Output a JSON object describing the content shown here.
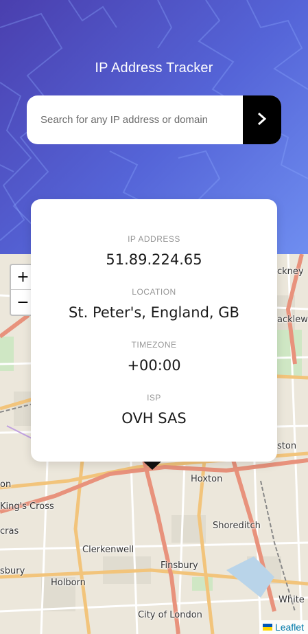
{
  "header": {
    "title": "IP Address Tracker"
  },
  "search": {
    "placeholder": "Search for any IP address or domain",
    "value": "",
    "button_icon": "chevron-right-icon"
  },
  "info": {
    "ip_label": "IP ADDRESS",
    "ip_value": "51.89.224.65",
    "location_label": "LOCATION",
    "location_value": "St. Peter's, England, GB",
    "timezone_label": "TIMEZONE",
    "timezone_value": "+00:00",
    "isp_label": "ISP",
    "isp_value": "OVH SAS"
  },
  "map": {
    "zoom_in": "+",
    "zoom_out": "−",
    "labels": {
      "hoxton": "Hoxton",
      "kings_cross": "King's Cross",
      "shoreditch": "Shoreditch",
      "clerkenwell": "Clerkenwell",
      "finsbury": "Finsbury",
      "holborn": "Holborn",
      "city_of_london": "City of London",
      "hackney": "ckney",
      "hacklewe": "acklewe",
      "aston": "ston",
      "white": "White",
      "crs": "cras",
      "sbury": "sbury",
      "on": "on"
    },
    "attribution": "Leaflet"
  },
  "colors": {
    "hero_start": "#4a3fae",
    "hero_end": "#6f8ef0",
    "button": "#000000",
    "card": "#ffffff"
  }
}
